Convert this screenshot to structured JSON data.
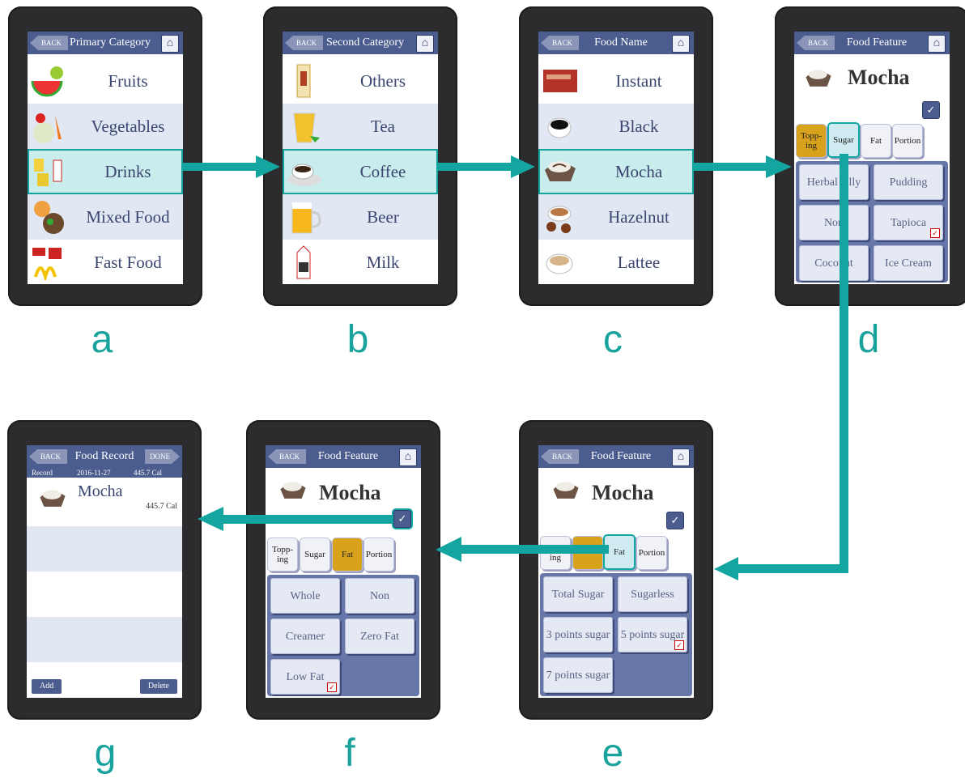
{
  "captions": [
    "a",
    "b",
    "c",
    "d",
    "e",
    "f",
    "g"
  ],
  "colors": {
    "arrow": "#15a5a0",
    "header": "#4b5c8f",
    "selected_tab": "#d9a21c"
  },
  "screen_a": {
    "back": "BACK",
    "title": "Primary Category",
    "home_icon": "home-icon",
    "rows": [
      {
        "label": "Fruits"
      },
      {
        "label": "Vegetables"
      },
      {
        "label": "Drinks"
      },
      {
        "label": "Mixed Food"
      },
      {
        "label": "Fast Food"
      }
    ],
    "selected": "Drinks"
  },
  "screen_b": {
    "back": "BACK",
    "title": "Second Category",
    "rows": [
      {
        "label": "Others"
      },
      {
        "label": "Tea"
      },
      {
        "label": "Coffee"
      },
      {
        "label": "Beer"
      },
      {
        "label": "Milk"
      }
    ],
    "selected": "Coffee"
  },
  "screen_c": {
    "back": "BACK",
    "title": "Food Name",
    "rows": [
      {
        "label": "Instant"
      },
      {
        "label": "Black"
      },
      {
        "label": "Mocha"
      },
      {
        "label": "Hazelnut"
      },
      {
        "label": "Lattee"
      }
    ],
    "selected": "Mocha"
  },
  "screen_d": {
    "back": "BACK",
    "title": "Food Feature",
    "food": "Mocha",
    "tabs": [
      "Topp-ing",
      "Sugar",
      "Fat",
      "Portion"
    ],
    "options": [
      "Herbal jelly",
      "Pudding",
      "Non",
      "Tapioca",
      "Coconut",
      "Ice Cream"
    ]
  },
  "screen_e": {
    "back": "BACK",
    "title": "Food Feature",
    "food": "Mocha",
    "tabs": [
      "Topp-ing",
      "Sugar",
      "Fat",
      "Portion"
    ],
    "options": [
      "Total Sugar",
      "Sugarless",
      "3 points sugar",
      "5 points sugar",
      "7 points sugar"
    ]
  },
  "screen_f": {
    "back": "BACK",
    "title": "Food Feature",
    "food": "Mocha",
    "tabs": [
      "Topp-ing",
      "Sugar",
      "Fat",
      "Portion"
    ],
    "options": [
      "Whole",
      "Non",
      "Creamer",
      "Zero Fat",
      "Low Fat"
    ]
  },
  "screen_g": {
    "back": "BACK",
    "title": "Food Record",
    "done": "DONE",
    "record_label": "Record",
    "date": "2016-11-27",
    "total": "445.7  Cal",
    "item_name": "Mocha",
    "item_cal": "445.7 Cal",
    "add": "Add",
    "delete": "Delete"
  }
}
